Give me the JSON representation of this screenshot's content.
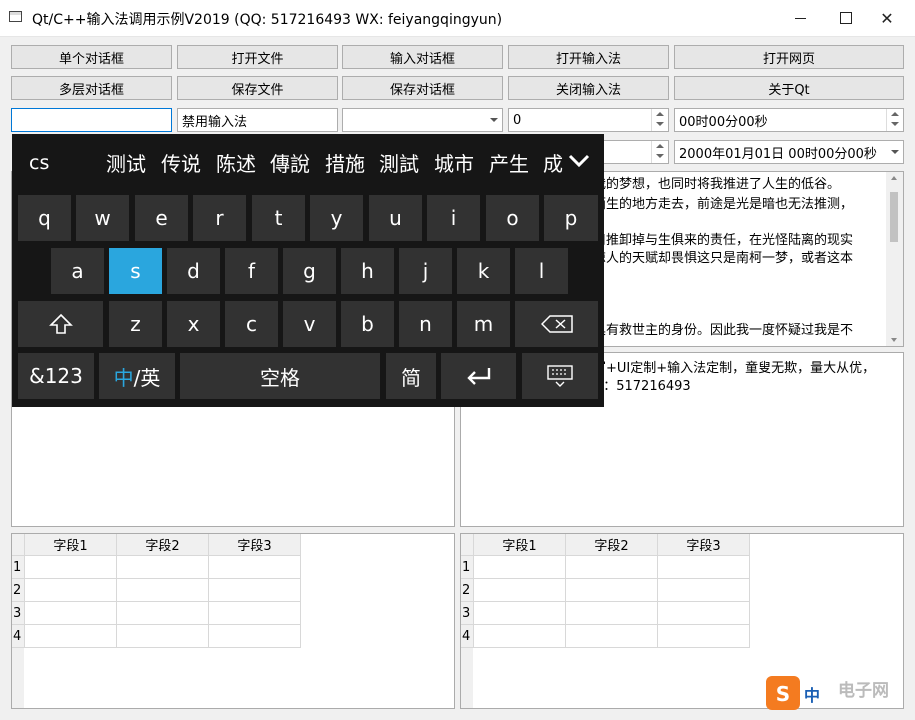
{
  "window": {
    "title": "Qt/C++输入法调用示例V2019 (QQ: 517216493  WX: feiyangqingyun)",
    "controls": {
      "minimize": "—",
      "maximize": "☐",
      "close": "✕"
    }
  },
  "buttons_row1": [
    "单个对话框",
    "打开文件",
    "输入对话框",
    "打开输入法",
    "打开网页"
  ],
  "buttons_row2": [
    "多层对话框",
    "保存文件",
    "保存对话框",
    "关闭输入法",
    "关于Qt"
  ],
  "row3": {
    "input_empty": "",
    "disabled_input": "禁用输入法",
    "combo_value": "",
    "spin_value": "0",
    "time_value": "00时00分00秒"
  },
  "row4": {
    "double_spin_value": "",
    "datetime_value": "2000年01月01日 00时00分00秒"
  },
  "text_right_top": [
    "我的梦想，也同时将我推进了人生的低谷。",
    "陌生的地方走去，前途是光是暗也无法推测，",
    "",
    "口推卸掉与生俱来的责任，在光怪陆离的现实",
    "惊人的天赋却畏惧这只是南柯一梦，或者这本",
    "",
    "",
    "具有救世主的身份。因此我一度怀疑过我是不"
  ],
  "text_right_mid": [
    "写+UI定制+输入法定制，童叟无欺，量大从优，",
    "Q：517216493"
  ],
  "table_left": {
    "headers": [
      "字段1",
      "字段2",
      "字段3"
    ],
    "row_numbers": [
      "1",
      "2",
      "3",
      "4"
    ]
  },
  "table_right": {
    "headers": [
      "字段1",
      "字段2",
      "字段3"
    ],
    "row_numbers": [
      "1",
      "2",
      "3",
      "4"
    ]
  },
  "ime": {
    "input_text": "cs",
    "candidates": [
      "测试",
      "传说",
      "陈述",
      "傳說",
      "措施",
      "測試",
      "城市",
      "产生",
      "成"
    ],
    "expand_icon": "chevron-down-icon",
    "row1": [
      "q",
      "w",
      "e",
      "r",
      "t",
      "y",
      "u",
      "i",
      "o",
      "p"
    ],
    "row2": [
      "a",
      "s",
      "d",
      "f",
      "g",
      "h",
      "j",
      "k",
      "l"
    ],
    "row3": [
      "z",
      "x",
      "c",
      "v",
      "b",
      "n",
      "m"
    ],
    "active_key": "s",
    "key_123": "&123",
    "key_zh": "中",
    "key_en": "/英",
    "key_space": "空格",
    "key_jian": "简",
    "accent_color": "#2aa6de"
  },
  "watermark": {
    "text": "电子网",
    "ime_tray": "中"
  }
}
